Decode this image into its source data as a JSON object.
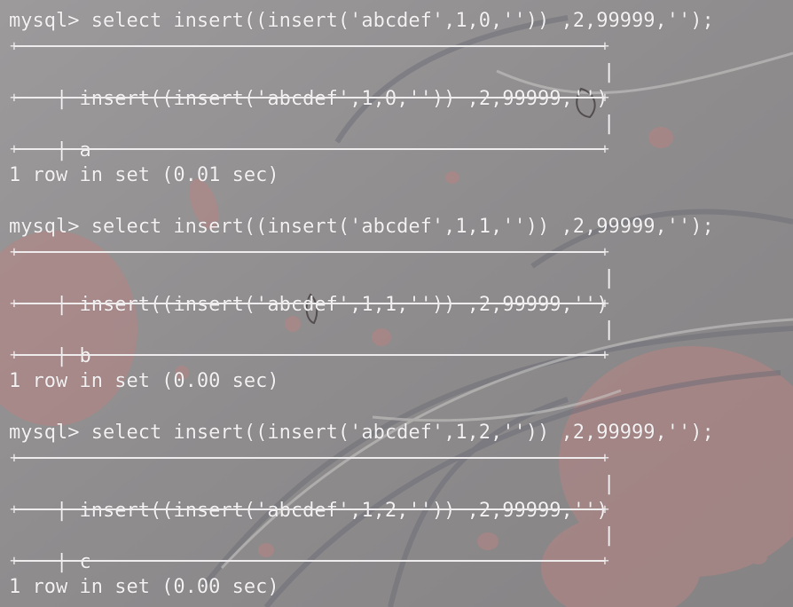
{
  "colors": {
    "background": "#8f8d8e",
    "text": "#f3f1f2",
    "accent_petal": "#c98a8a"
  },
  "terminal": {
    "blocks": [
      {
        "command": "mysql> select insert((insert('abcdef',1,0,'')) ,2,99999,'');",
        "header": "insert((insert('abcdef',1,0,'')) ,2,99999,'')",
        "value": "a",
        "status": "1 row in set (0.01 sec)"
      },
      {
        "command": "mysql> select insert((insert('abcdef',1,1,'')) ,2,99999,'');",
        "header": "insert((insert('abcdef',1,1,'')) ,2,99999,'')",
        "value": "b",
        "status": "1 row in set (0.00 sec)"
      },
      {
        "command": "mysql> select insert((insert('abcdef',1,2,'')) ,2,99999,'');",
        "header": "insert((insert('abcdef',1,2,'')) ,2,99999,'')",
        "value": "c",
        "status": "1 row in set (0.00 sec)"
      }
    ]
  }
}
